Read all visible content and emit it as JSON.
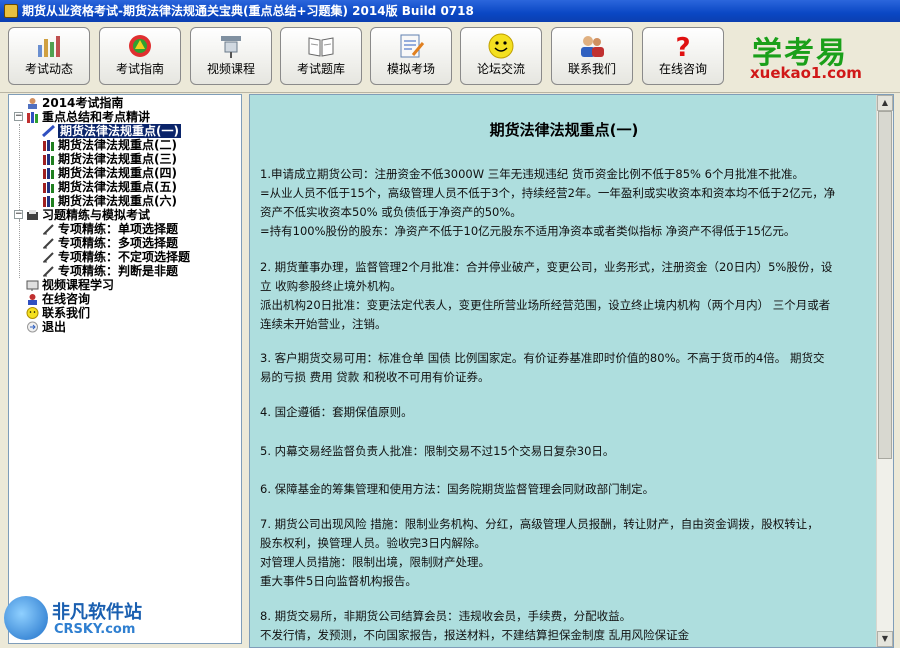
{
  "window": {
    "title": "期货从业资格考试-期货法律法规通关宝典(重点总结+习题集) 2014版 Build 0718"
  },
  "toolbar": {
    "buttons": [
      {
        "label": "考试动态",
        "icon": "bar-chart-icon"
      },
      {
        "label": "考试指南",
        "icon": "compass-icon"
      },
      {
        "label": "视频课程",
        "icon": "projector-icon"
      },
      {
        "label": "考试题库",
        "icon": "book-icon"
      },
      {
        "label": "模拟考场",
        "icon": "exam-paper-icon"
      },
      {
        "label": "论坛交流",
        "icon": "smiley-icon"
      },
      {
        "label": "联系我们",
        "icon": "people-icon"
      },
      {
        "label": "在线咨询",
        "icon": "question-icon"
      }
    ]
  },
  "logo": {
    "cn": "学考易",
    "en": "xuekao1.com"
  },
  "tree": {
    "items": [
      {
        "label": "2014考试指南",
        "icon": "guide-icon"
      },
      {
        "label": "重点总结和考点精讲",
        "icon": "folder-books-icon"
      },
      {
        "label": "期货法律法规重点(一)",
        "icon": "pen-icon"
      },
      {
        "label": "期货法律法规重点(二)",
        "icon": "books-icon"
      },
      {
        "label": "期货法律法规重点(三)",
        "icon": "books-icon"
      },
      {
        "label": "期货法律法规重点(四)",
        "icon": "books-icon"
      },
      {
        "label": "期货法律法规重点(五)",
        "icon": "books-icon"
      },
      {
        "label": "期货法律法规重点(六)",
        "icon": "books-icon"
      },
      {
        "label": "习题精练与模拟考试",
        "icon": "folder-books-icon"
      },
      {
        "label": "专项精练：单项选择题",
        "icon": "pencil-icon"
      },
      {
        "label": "专项精练：多项选择题",
        "icon": "pencil-icon"
      },
      {
        "label": "专项精练：不定项选择题",
        "icon": "pencil-icon"
      },
      {
        "label": "专项精练：判断是非题",
        "icon": "pencil-icon"
      },
      {
        "label": "视频课程学习",
        "icon": "video-icon"
      },
      {
        "label": "在线咨询",
        "icon": "person-icon"
      },
      {
        "label": "联系我们",
        "icon": "smiley-icon"
      },
      {
        "label": "退出",
        "icon": "exit-icon"
      }
    ]
  },
  "content": {
    "title": "期货法律法规重点(一)",
    "paragraphs": [
      [
        "1.申请成立期货公司：注册资金不低3000W 三年无违规违纪  货币资金比例不低于85%  6个月批准不批准。",
        "=从业人员不低于15个，高级管理人员不低于3个，持续经营2年。一年盈利或实收资本和资本均不低于2亿元，净",
        "资产不低实收资本50% 或负债低于净资产的50%。",
        "=持有100%股份的股东：净资产不低于10亿元股东不适用净资本或者类似指标  净资产不得低于15亿元。"
      ],
      [
        "2. 期货董事办理，监督管理2个月批准：合并停业破产，变更公司，业务形式，注册资金（20日内）5%股份，设",
        "立  收购参股终止境外机构。",
        "派出机构20日批准：变更法定代表人，变更住所营业场所经营范围，设立终止境内机构（两个月内）  三个月或者",
        "连续未开始营业，注销。"
      ],
      [
        "3. 客户期货交易可用：标准仓单  国债  比例国家定。有价证券基准即时价值的80%。不高于货币的4倍。  期货交",
        "易的亏损  费用  贷款  和税收不可用有价证券。"
      ],
      [
        "4. 国企遵循：套期保值原则。"
      ],
      [
        "5. 内幕交易经监督负责人批准：限制交易不过15个交易日复杂30日。"
      ],
      [
        "6. 保障基金的筹集管理和使用方法：国务院期货监督管理会同财政部门制定。"
      ],
      [
        "7. 期货公司出现风险  措施：限制业务机构、分红，高级管理人员报酬，转让财产，自由资金调拨，股权转让，",
        "股东权利，换管理人员。验收完3日内解除。",
        "对管理人员措施：限制出境，限制财产处理。",
        "重大事件5日向监督机构报告。"
      ],
      [
        "8. 期货交易所，非期货公司结算会员：违规收会员，手续费，分配收益。",
        "不发行情，发预测，不向国家报告，报送材料，不建结算担保金制度  乱用风险保证金"
      ]
    ]
  },
  "watermark": {
    "cn": "非凡软件站",
    "en": "CRSKY.com"
  }
}
